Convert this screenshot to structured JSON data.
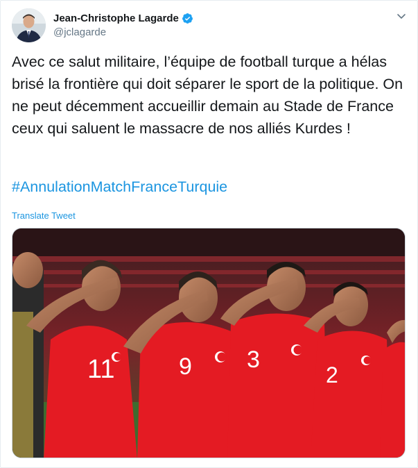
{
  "author": {
    "display_name": "Jean-Christophe Lagarde",
    "handle": "@jclagarde",
    "verified": true,
    "avatar_icon": "avatar-photo"
  },
  "tweet": {
    "text": "Avec ce salut militaire, l’équipe de football turque a hélas brisé la frontière qui doit séparer le sport de la politique. On ne peut décemment accueillir demain au Stade de France ceux qui saluent le massacre de nos alliés Kurdes !",
    "hashtag": "#AnnulationMatchFranceTurquie",
    "translate_label": "Translate Tweet"
  },
  "media": {
    "jersey_numbers": [
      "11",
      "9",
      "3",
      "2"
    ]
  },
  "colors": {
    "link": "#1b95e0",
    "verified": "#1da1f2",
    "jersey": "#e41b23",
    "text": "#14171a",
    "secondary": "#657786"
  }
}
